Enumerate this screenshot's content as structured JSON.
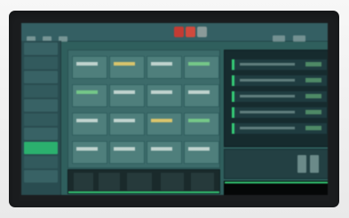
{
  "window": {
    "title": "",
    "brand_color": "#2f5f5d",
    "accent_color": "#37d37a"
  },
  "titlebar": {
    "controls": [
      {
        "name": "minimize-icon",
        "color": "#c33b33"
      },
      {
        "name": "maximize-icon",
        "color": "#d04a3d"
      },
      {
        "name": "close-icon",
        "color": "#8a9a99"
      }
    ]
  },
  "sidebar": {
    "items": [
      {
        "label": ""
      },
      {
        "label": ""
      },
      {
        "label": ""
      },
      {
        "label": ""
      },
      {
        "label": ""
      },
      {
        "label": ""
      },
      {
        "label": ""
      },
      {
        "label": ""
      },
      {
        "label": ""
      },
      {
        "label": ""
      }
    ],
    "active_index": 7
  },
  "main": {
    "grid_cells": 16
  }
}
